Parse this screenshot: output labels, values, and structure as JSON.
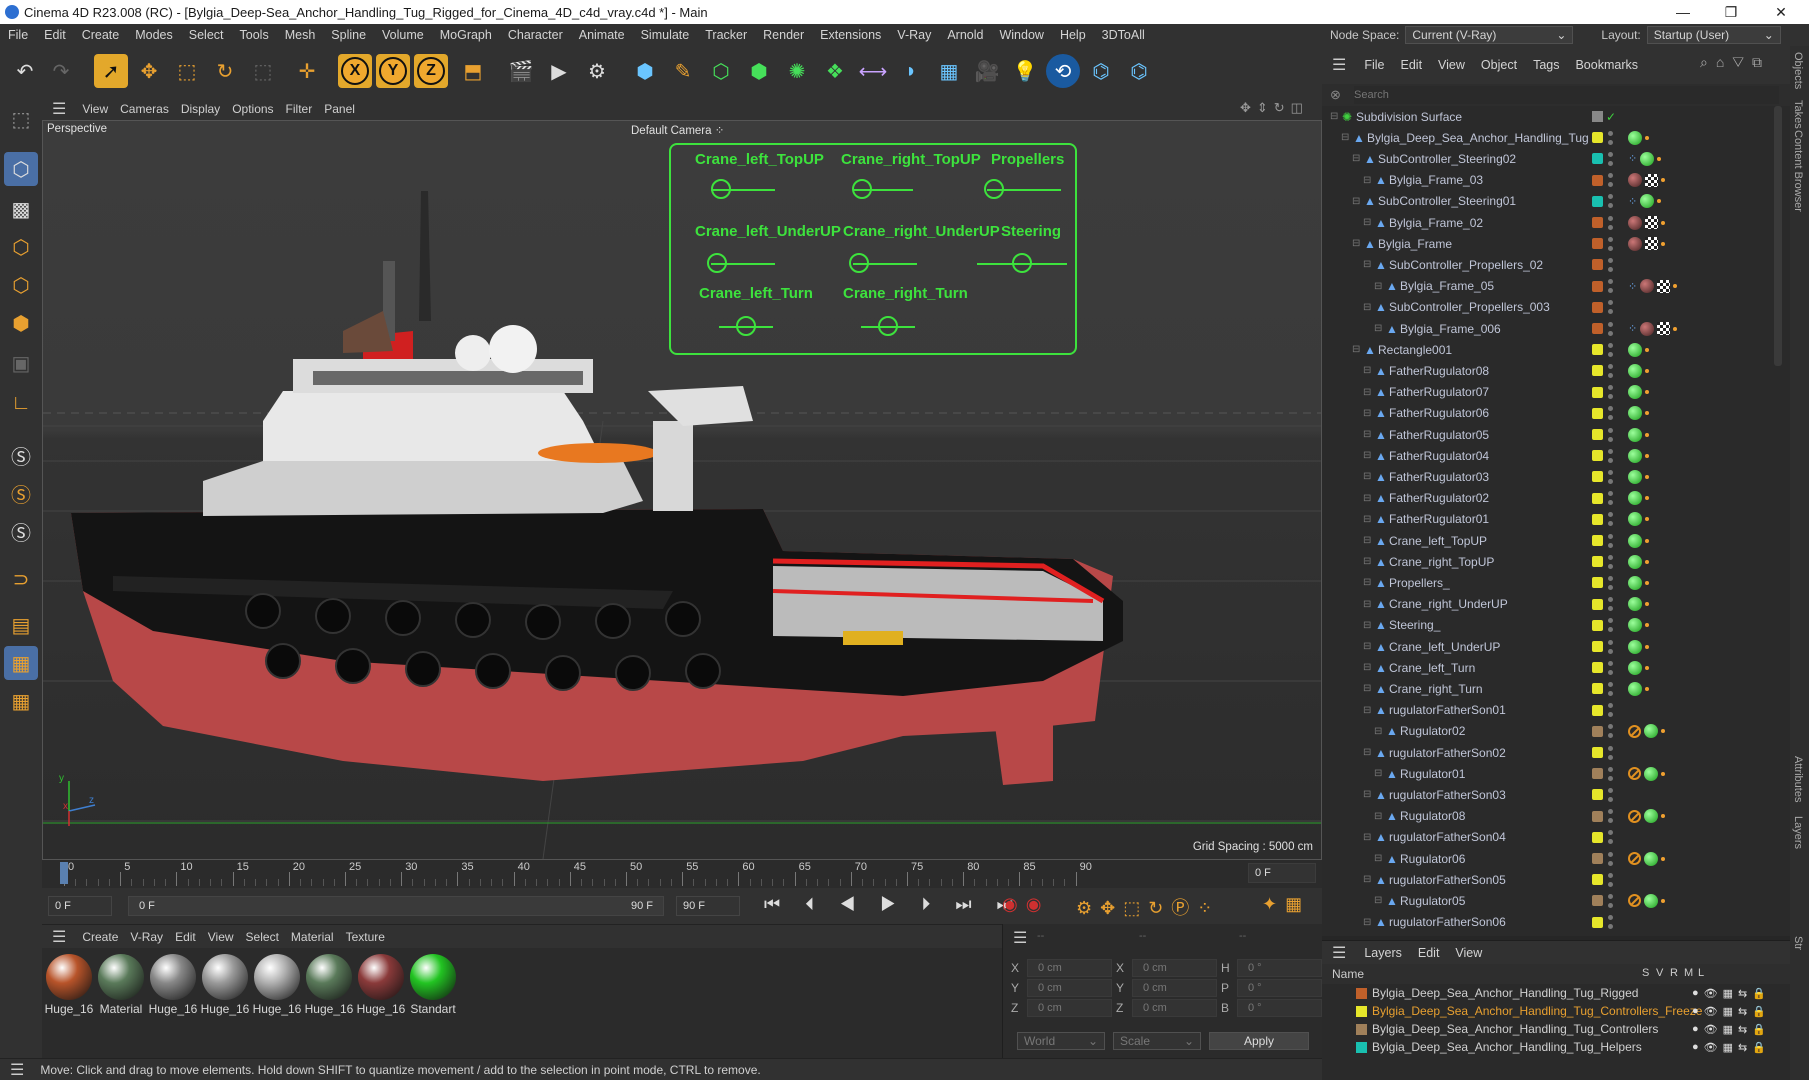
{
  "window": {
    "title": "Cinema 4D R23.008 (RC) - [Bylgia_Deep-Sea_Anchor_Handling_Tug_Rigged_for_Cinema_4D_c4d_vray.c4d *] - Main",
    "minimize": "—",
    "maximize": "❐",
    "close": "✕"
  },
  "menubar": [
    "File",
    "Edit",
    "Create",
    "Modes",
    "Select",
    "Tools",
    "Mesh",
    "Spline",
    "Volume",
    "MoGraph",
    "Character",
    "Animate",
    "Simulate",
    "Tracker",
    "Render",
    "Extensions",
    "V-Ray",
    "Arnold",
    "Window",
    "Help",
    "3DToAll"
  ],
  "node_space": {
    "label": "Node Space:",
    "value": "Current (V-Ray)"
  },
  "layout": {
    "label": "Layout:",
    "value": "Startup (User)"
  },
  "viewport": {
    "menu": [
      "View",
      "Cameras",
      "Display",
      "Options",
      "Filter",
      "Panel"
    ],
    "projection": "Perspective",
    "camera": "Default Camera",
    "grid_spacing": "Grid Spacing : 5000 cm",
    "hud": [
      {
        "label": "Crane_left_TopUP",
        "level": 0.15
      },
      {
        "label": "Crane_right_TopUP",
        "level": 0.15
      },
      {
        "label": "Propellers",
        "level": 0.1
      },
      {
        "label": "Crane_left_UnderUP",
        "level": 0.1
      },
      {
        "label": "Crane_right_UnderUP",
        "level": 0.1
      },
      {
        "label": "Steering",
        "level": 0.5
      },
      {
        "label": "Crane_left_Turn",
        "level": 0.5
      },
      {
        "label": "Crane_right_Turn",
        "level": 0.5
      }
    ]
  },
  "timeline": {
    "ticks": [
      "0",
      "5",
      "10",
      "15",
      "20",
      "25",
      "30",
      "35",
      "40",
      "45",
      "50",
      "55",
      "60",
      "65",
      "70",
      "75",
      "80",
      "85",
      "90"
    ],
    "current": "0 F"
  },
  "transport": {
    "start": "0 F",
    "range_start": "0 F",
    "range_end": "90 F",
    "end": "90 F"
  },
  "material_manager": {
    "menu": [
      "Create",
      "V-Ray",
      "Edit",
      "View",
      "Select",
      "Material",
      "Texture"
    ],
    "materials": [
      {
        "label": "Huge_16",
        "color": "#b8542a"
      },
      {
        "label": "Material",
        "color": "#5a7a5a"
      },
      {
        "label": "Huge_16",
        "color": "#888888"
      },
      {
        "label": "Huge_16",
        "color": "#9a9a9a"
      },
      {
        "label": "Huge_16",
        "color": "#b0b0b0"
      },
      {
        "label": "Huge_16",
        "color": "#5a7a5a"
      },
      {
        "label": "Huge_16",
        "color": "#8a3a3a"
      },
      {
        "label": "Standart",
        "color": "#22c422"
      }
    ]
  },
  "coordinates": {
    "rows": [
      {
        "a": "X",
        "av": "0 cm",
        "b": "X",
        "bv": "0 cm",
        "c": "H",
        "cv": "0 °"
      },
      {
        "a": "Y",
        "av": "0 cm",
        "b": "Y",
        "bv": "0 cm",
        "c": "P",
        "cv": "0 °"
      },
      {
        "a": "Z",
        "av": "0 cm",
        "b": "Z",
        "bv": "0 cm",
        "c": "B",
        "cv": "0 °"
      }
    ],
    "mode": "World",
    "scale": "Scale",
    "apply": "Apply",
    "dashes": "--"
  },
  "status": "Move: Click and drag to move elements. Hold down SHIFT to quantize movement / add to the selection in point mode, CTRL to remove.",
  "object_manager": {
    "menu": [
      "File",
      "Edit",
      "View",
      "Object",
      "Tags",
      "Bookmarks"
    ],
    "search_placeholder": "Search",
    "objects": [
      {
        "name": "Subdivision Surface",
        "depth": 0,
        "layer": "#888888",
        "tags": "check"
      },
      {
        "name": "Bylgia_Deep_Sea_Anchor_Handling_Tug",
        "depth": 1,
        "layer": "#e6e62a",
        "tags": "g"
      },
      {
        "name": "SubController_Steering02",
        "depth": 2,
        "layer": "#19c0b0",
        "tags": "sgo"
      },
      {
        "name": "Bylgia_Frame_03",
        "depth": 3,
        "layer": "#c0602a",
        "tags": "rc"
      },
      {
        "name": "SubController_Steering01",
        "depth": 2,
        "layer": "#19c0b0",
        "tags": "sgo"
      },
      {
        "name": "Bylgia_Frame_02",
        "depth": 3,
        "layer": "#c0602a",
        "tags": "rc"
      },
      {
        "name": "Bylgia_Frame",
        "depth": 2,
        "layer": "#c0602a",
        "tags": "rc"
      },
      {
        "name": "SubController_Propellers_02",
        "depth": 3,
        "layer": "#c0602a",
        "tags": ""
      },
      {
        "name": "Bylgia_Frame_05",
        "depth": 4,
        "layer": "#c0602a",
        "tags": "src"
      },
      {
        "name": "SubController_Propellers_003",
        "depth": 3,
        "layer": "#c0602a",
        "tags": ""
      },
      {
        "name": "Bylgia_Frame_006",
        "depth": 4,
        "layer": "#c0602a",
        "tags": "src"
      },
      {
        "name": "Rectangle001",
        "depth": 2,
        "layer": "#e6e62a",
        "tags": "g"
      },
      {
        "name": "FatherRugulator08",
        "depth": 3,
        "layer": "#e6e62a",
        "tags": "g"
      },
      {
        "name": "FatherRugulator07",
        "depth": 3,
        "layer": "#e6e62a",
        "tags": "g"
      },
      {
        "name": "FatherRugulator06",
        "depth": 3,
        "layer": "#e6e62a",
        "tags": "g"
      },
      {
        "name": "FatherRugulator05",
        "depth": 3,
        "layer": "#e6e62a",
        "tags": "g"
      },
      {
        "name": "FatherRugulator04",
        "depth": 3,
        "layer": "#e6e62a",
        "tags": "g"
      },
      {
        "name": "FatherRugulator03",
        "depth": 3,
        "layer": "#e6e62a",
        "tags": "g"
      },
      {
        "name": "FatherRugulator02",
        "depth": 3,
        "layer": "#e6e62a",
        "tags": "g"
      },
      {
        "name": "FatherRugulator01",
        "depth": 3,
        "layer": "#e6e62a",
        "tags": "g"
      },
      {
        "name": "Crane_left_TopUP",
        "depth": 3,
        "layer": "#e6e62a",
        "tags": "g"
      },
      {
        "name": "Crane_right_TopUP",
        "depth": 3,
        "layer": "#e6e62a",
        "tags": "g"
      },
      {
        "name": "Propellers_",
        "depth": 3,
        "layer": "#e6e62a",
        "tags": "g"
      },
      {
        "name": "Crane_right_UnderUP",
        "depth": 3,
        "layer": "#e6e62a",
        "tags": "g"
      },
      {
        "name": "Steering_",
        "depth": 3,
        "layer": "#e6e62a",
        "tags": "g"
      },
      {
        "name": "Crane_left_UnderUP",
        "depth": 3,
        "layer": "#e6e62a",
        "tags": "g"
      },
      {
        "name": "Crane_left_Turn",
        "depth": 3,
        "layer": "#e6e62a",
        "tags": "g"
      },
      {
        "name": "Crane_right_Turn",
        "depth": 3,
        "layer": "#e6e62a",
        "tags": "g"
      },
      {
        "name": "rugulatorFatherSon01",
        "depth": 3,
        "layer": "#e6e62a",
        "tags": ""
      },
      {
        "name": "Rugulator02",
        "depth": 4,
        "layer": "#a0805a",
        "tags": "ng"
      },
      {
        "name": "rugulatorFatherSon02",
        "depth": 3,
        "layer": "#e6e62a",
        "tags": ""
      },
      {
        "name": "Rugulator01",
        "depth": 4,
        "layer": "#a0805a",
        "tags": "ng"
      },
      {
        "name": "rugulatorFatherSon03",
        "depth": 3,
        "layer": "#e6e62a",
        "tags": ""
      },
      {
        "name": "Rugulator08",
        "depth": 4,
        "layer": "#a0805a",
        "tags": "ng"
      },
      {
        "name": "rugulatorFatherSon04",
        "depth": 3,
        "layer": "#e6e62a",
        "tags": ""
      },
      {
        "name": "Rugulator06",
        "depth": 4,
        "layer": "#a0805a",
        "tags": "ng"
      },
      {
        "name": "rugulatorFatherSon05",
        "depth": 3,
        "layer": "#e6e62a",
        "tags": ""
      },
      {
        "name": "Rugulator05",
        "depth": 4,
        "layer": "#a0805a",
        "tags": "ng"
      },
      {
        "name": "rugulatorFatherSon06",
        "depth": 3,
        "layer": "#e6e62a",
        "tags": ""
      }
    ]
  },
  "layers": {
    "menu": [
      "Layers",
      "Edit",
      "View"
    ],
    "header": {
      "name": "Name",
      "cols": [
        "S",
        "V",
        "R",
        "M",
        "L"
      ]
    },
    "items": [
      {
        "name": "Bylgia_Deep_Sea_Anchor_Handling_Tug_Rigged",
        "color": "#c0602a",
        "text_color": "#d0d0d0"
      },
      {
        "name": "Bylgia_Deep_Sea_Anchor_Handling_Tug_Controllers_Freeze",
        "color": "#e6e62a",
        "text_color": "#e8a030"
      },
      {
        "name": "Bylgia_Deep_Sea_Anchor_Handling_Tug_Controllers",
        "color": "#a0805a",
        "text_color": "#d0d0d0"
      },
      {
        "name": "Bylgia_Deep_Sea_Anchor_Handling_Tug_Helpers",
        "color": "#19c0b0",
        "text_color": "#d0d0d0"
      }
    ]
  },
  "side_tabs": [
    "Objects",
    "Takes",
    "Content Browser",
    "Attributes",
    "Layers",
    "Str"
  ]
}
